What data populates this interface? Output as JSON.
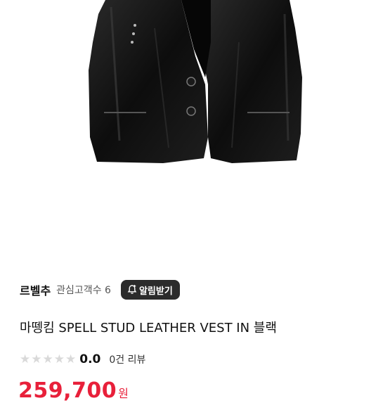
{
  "store": {
    "name": "르벨추",
    "follower_label": "관심고객수 6",
    "alarm_button_label": "알림받기"
  },
  "product": {
    "title": "마뗑킴 SPELL STUD LEATHER VEST IN 블랙",
    "image": {
      "icon": "black-leather-vest-image"
    }
  },
  "rating": {
    "stars_filled": 0,
    "stars_total": 5,
    "value": "0.0",
    "review_label": "0건 리뷰"
  },
  "price": {
    "value": "259,700",
    "unit": "원",
    "color": "#e8203a"
  }
}
